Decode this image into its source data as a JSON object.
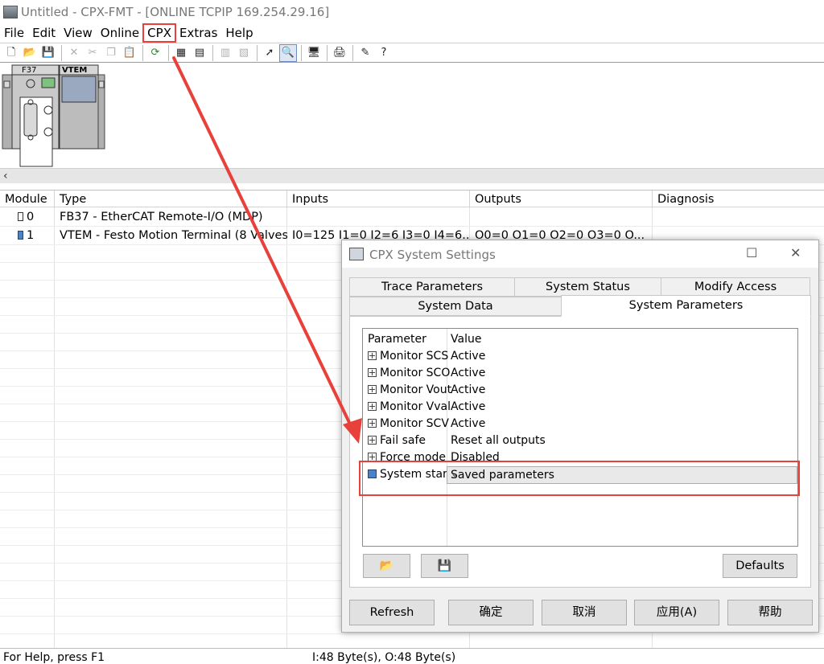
{
  "window": {
    "title": "Untitled - CPX-FMT - [ONLINE TCPIP 169.254.29.16]"
  },
  "menu": {
    "items": [
      "File",
      "Edit",
      "View",
      "Online",
      "CPX",
      "Extras",
      "Help"
    ]
  },
  "toolbar": {
    "icons": [
      "new-icon",
      "open-icon",
      "save-icon",
      "cut-icon",
      "scissors-icon",
      "copy-icon",
      "paste-icon",
      "refresh-icon",
      "module-icon",
      "module-grid-icon",
      "upload-icon",
      "download-icon",
      "pointer-icon",
      "zoom-icon",
      "monitor-icon",
      "print-icon",
      "wand-icon",
      "help-icon"
    ]
  },
  "rack": {
    "module_f37": "F37",
    "module_vtem": "VTEM"
  },
  "grid": {
    "headers": [
      "Module",
      "Type",
      "Inputs",
      "Outputs",
      "Diagnosis"
    ],
    "rows": [
      {
        "module": "0",
        "type": "FB37 - EtherCAT Remote-I/O (MDP)",
        "inputs": "",
        "outputs": ""
      },
      {
        "module": "1",
        "type": "VTEM - Festo Motion Terminal (8 Valves)",
        "inputs": "I0=125  I1=0  I2=6  I3=0  I4=6...",
        "outputs": "O0=0  O1=0  O2=0  O3=0  O..."
      }
    ]
  },
  "status": {
    "help": "For Help, press F1",
    "io": "I:48 Byte(s), O:48 Byte(s)"
  },
  "dialog": {
    "title": "CPX System Settings",
    "tabs_row1": [
      "Trace Parameters",
      "System Status",
      "Modify Access"
    ],
    "tabs_row2": [
      "System Data",
      "System Parameters"
    ],
    "list_headers": {
      "param": "Parameter",
      "value": "Value"
    },
    "params": [
      {
        "name": "Monitor SCS",
        "value": "Active"
      },
      {
        "name": "Monitor SCO",
        "value": "Active"
      },
      {
        "name": "Monitor Vout",
        "value": "Active"
      },
      {
        "name": "Monitor Vval",
        "value": "Active"
      },
      {
        "name": "Monitor SCV",
        "value": "Active"
      },
      {
        "name": "Fail safe",
        "value": "Reset all outputs"
      },
      {
        "name": "Force mode",
        "value": "Disabled"
      }
    ],
    "selected_param": {
      "name": "System start",
      "value": "Saved parameters"
    },
    "defaults_label": "Defaults",
    "buttons": {
      "refresh": "Refresh",
      "ok": "确定",
      "cancel": "取消",
      "apply": "应用(A)",
      "help": "帮助"
    }
  },
  "colors": {
    "annotation": "#e8413c",
    "selected": "#4b82c8"
  }
}
